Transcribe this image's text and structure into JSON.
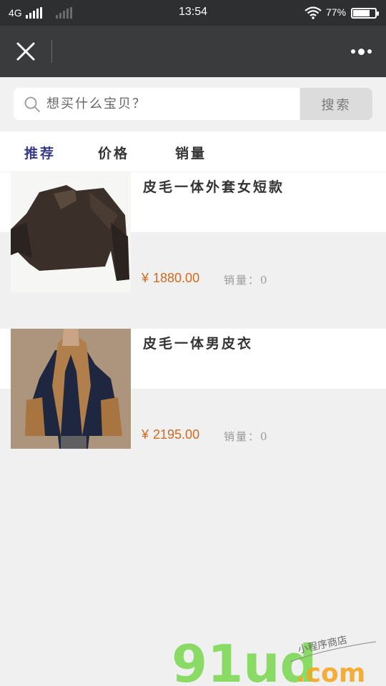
{
  "status_bar": {
    "network": "4G",
    "time": "13:54",
    "battery_percent": "77%",
    "battery_level": 0.77
  },
  "nav": {
    "close_icon": "close-icon",
    "more_icon": "more-dots-icon"
  },
  "search": {
    "placeholder": "想买什么宝贝？",
    "button_label": "搜索"
  },
  "tabs": [
    {
      "label": "推荐",
      "active": true
    },
    {
      "label": "价格",
      "active": false
    },
    {
      "label": "销量",
      "active": false
    }
  ],
  "products": [
    {
      "name": "皮毛一体外套女短款",
      "currency": "¥",
      "price": "1880.00",
      "sales": "销量：0"
    },
    {
      "name": "皮毛一体男皮衣",
      "currency": "¥",
      "price": "2195.00",
      "sales": "销量：0"
    }
  ],
  "watermark": {
    "brand": "91ud",
    "domain": ".com",
    "tagline": "小程序商店"
  },
  "colors": {
    "active_tab": "#3a3a8a",
    "price": "#d2691e",
    "nav_bg": "#3a3b3d",
    "brand_green": "#7ed957",
    "brand_orange": "#f5a623"
  }
}
